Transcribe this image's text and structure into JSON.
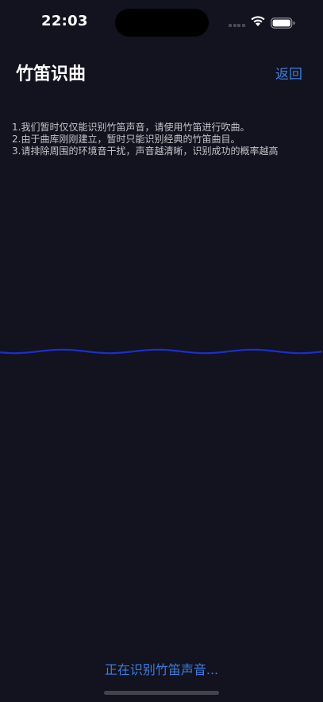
{
  "status_bar": {
    "time": "22:03"
  },
  "header": {
    "title": "竹笛识曲",
    "back_label": "返回"
  },
  "instructions": [
    "1.我们暂时仅仅能识别竹笛声音，请使用竹笛进行吹曲。",
    "2.由于曲库刚刚建立，暂时只能识别经典的竹笛曲目。",
    "3.请排除周围的环境音干扰，声音越清晰，识别成功的概率越高"
  ],
  "status_text": "正在识别竹笛声音...",
  "colors": {
    "background": "#13121f",
    "accent": "#3a7fe0",
    "wave": "#1a2fcf"
  },
  "icons": [
    "signal-icon",
    "wifi-icon",
    "battery-icon"
  ]
}
